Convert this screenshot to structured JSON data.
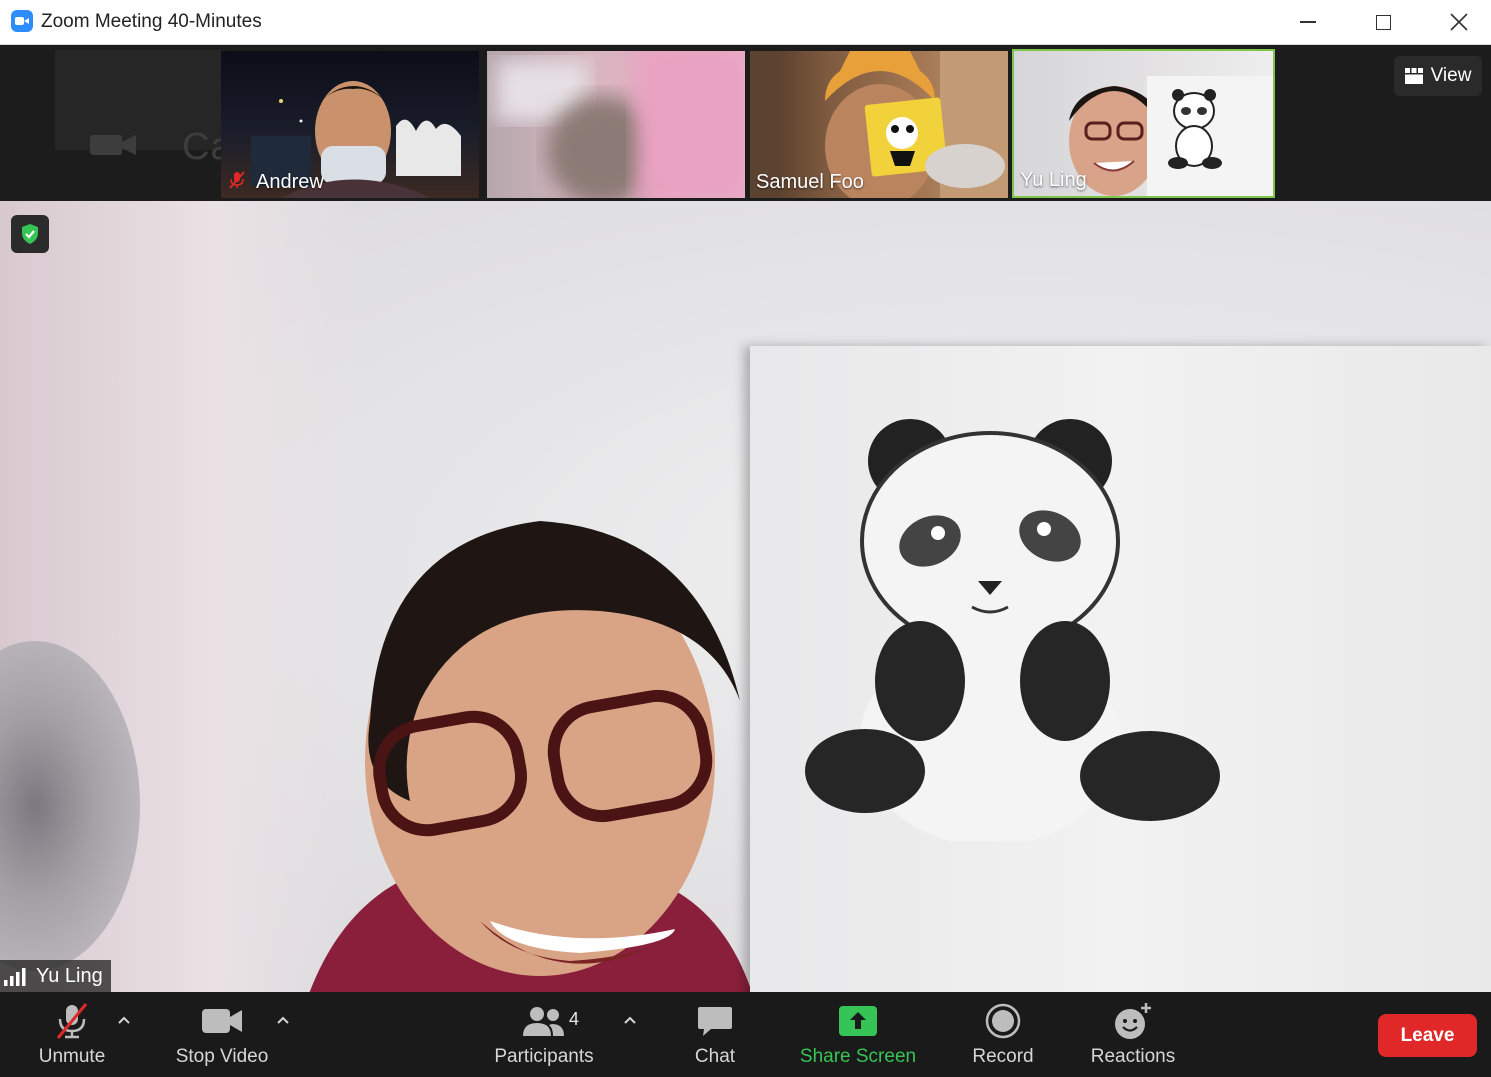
{
  "window": {
    "title": "Zoom Meeting 40-Minutes",
    "controls": [
      "minimize",
      "maximize",
      "close"
    ]
  },
  "colors": {
    "accent_blue": "#2d8cff",
    "active_speaker_border": "#7ec64a",
    "leave_red": "#e02828",
    "share_green": "#37c456",
    "muted_red": "#e02828"
  },
  "strip": {
    "camera_off_label": "Camera on",
    "participants": [
      {
        "name": "Andrew",
        "muted": true
      },
      {
        "name": "",
        "blurred": true
      },
      {
        "name": "Samuel Foo",
        "muted": false
      },
      {
        "name": "Yu Ling",
        "active": true
      }
    ],
    "view_button": "View"
  },
  "main": {
    "speaker_name": "Yu Ling",
    "security_icon": "shield-check-icon"
  },
  "toolbar": {
    "unmute": "Unmute",
    "stop_video": "Stop Video",
    "participants": "Participants",
    "participant_count": "4",
    "chat": "Chat",
    "share_screen": "Share Screen",
    "record": "Record",
    "reactions": "Reactions",
    "leave": "Leave"
  }
}
